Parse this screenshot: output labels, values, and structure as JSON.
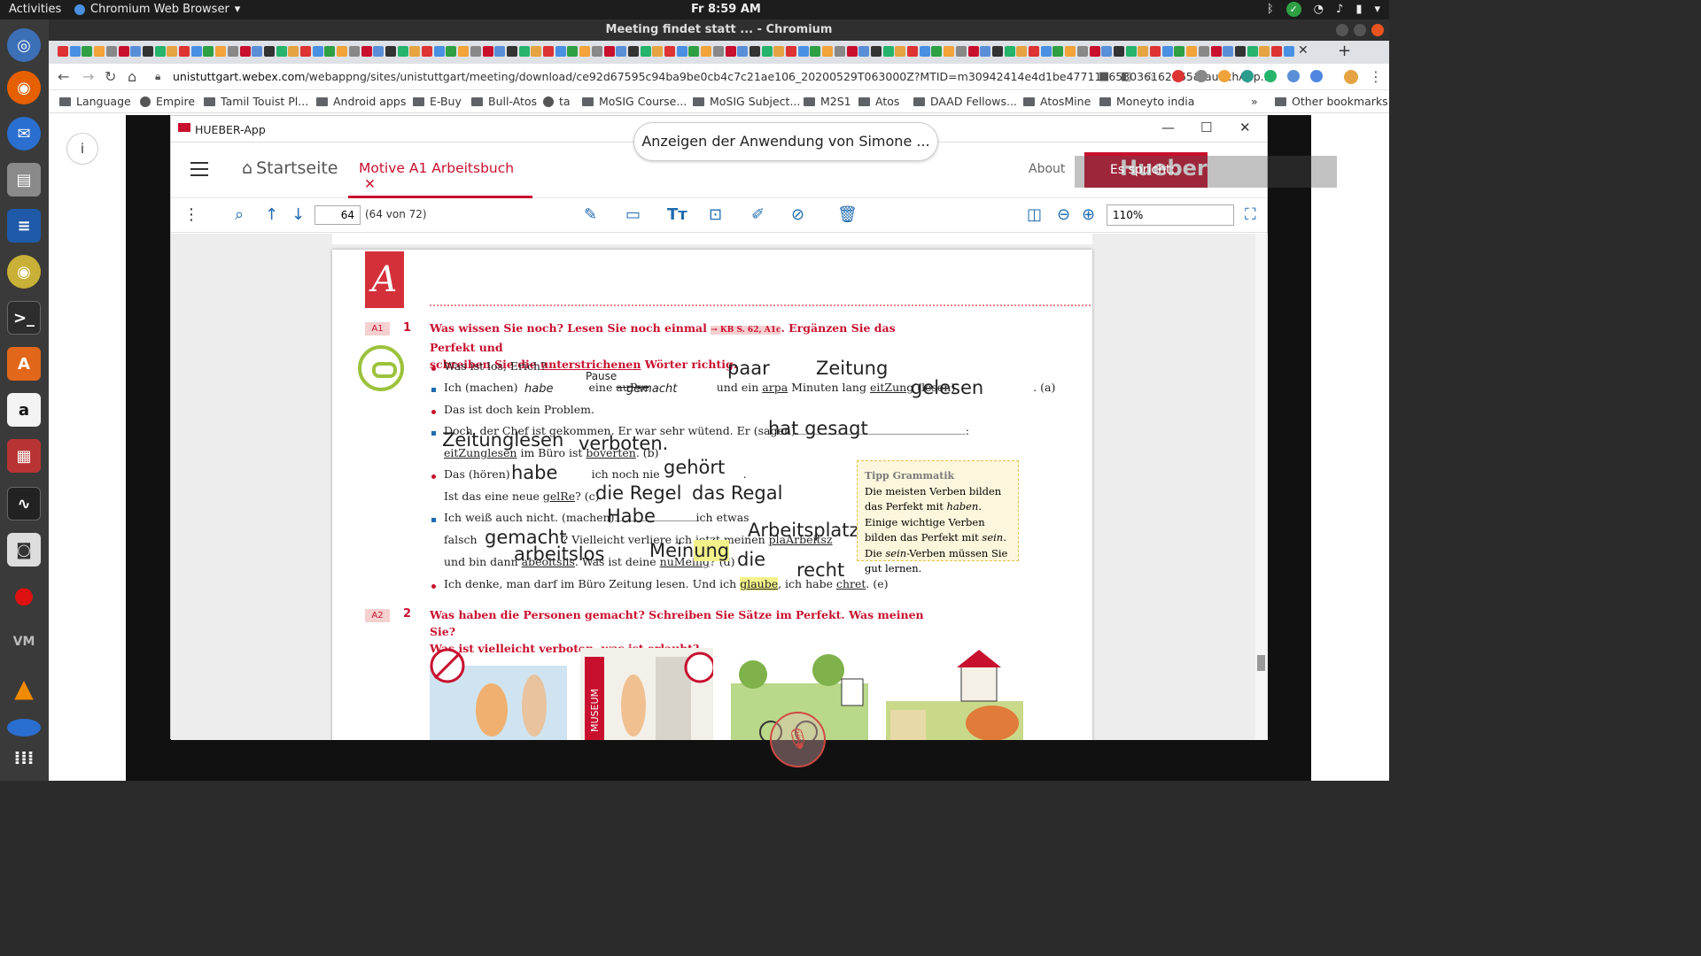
{
  "topbar": {
    "activities": "Activities",
    "app_name": "Chromium Web Browser",
    "clock": "Fr  8:59 AM"
  },
  "window": {
    "title": "Meeting findet statt ... - Chromium"
  },
  "navbar": {
    "url_host": "unistuttgart.webex.com",
    "url_path": "/webappng/sites/unistuttgart/meeting/download/ce92d67595c94ba9be0cb4c7c21ae106_20200529T063000Z?MTID=m30942414e4d1be477113653036162165&launchApp..."
  },
  "bookmarks": [
    {
      "label": "Language",
      "icon": "folder-icon"
    },
    {
      "label": "Empire",
      "icon": "globe-icon"
    },
    {
      "label": "Tamil Touist Pl...",
      "icon": "folder-icon"
    },
    {
      "label": "Android apps",
      "icon": "folder-icon"
    },
    {
      "label": "E-Buy",
      "icon": "folder-icon"
    },
    {
      "label": "Bull-Atos",
      "icon": "folder-icon"
    },
    {
      "label": "ta",
      "icon": "page-icon"
    },
    {
      "label": "MoSIG Course...",
      "icon": "folder-icon"
    },
    {
      "label": "MoSIG Subject...",
      "icon": "folder-icon"
    },
    {
      "label": "M2S1",
      "icon": "folder-icon"
    },
    {
      "label": "Atos",
      "icon": "folder-icon"
    },
    {
      "label": "DAAD Fellows...",
      "icon": "folder-icon"
    },
    {
      "label": "AtosMine",
      "icon": "folder-icon"
    },
    {
      "label": "Moneyto india",
      "icon": "folder-icon"
    }
  ],
  "bookmarks_overflow": "»",
  "other_bookmarks": "Other bookmarks",
  "share_banner": "Anzeigen der Anwendung von Simone ...",
  "hueber": {
    "window_title": "HUEBER-App",
    "home": "Startseite",
    "book_tab": "Motive A1 Arbeitsbuch",
    "about": "About",
    "logo": "Hueber",
    "speaking": "Es spricht:",
    "page_input": "64",
    "page_count": "(64 von 72)",
    "zoom": "110%"
  },
  "pdf": {
    "letter": "A",
    "ex1": {
      "badge": "A1",
      "num": "1",
      "task_1": "Was wissen Sie noch? Lesen Sie noch einmal",
      "task_ref": "→ KB S. 62, A1c",
      "task_2": ". Ergänzen Sie das Perfekt und",
      "task_3a": "schreiben Sie die ",
      "task_3u": "unterstrichenen",
      "task_3b": " Wörter richtig."
    },
    "ex2": {
      "badge": "A2",
      "num": "2",
      "task_1": "Was haben die Personen gemacht? Schreiben Sie Sätze im Perfekt. Was meinen Sie?",
      "task_2": "Was ist vielleicht verboten, was ist erlaubt?"
    },
    "lines": {
      "l1": "Was ist los, Erich?",
      "l2a": "Ich (machen)",
      "l2b": "eine",
      "l2c": "auPse",
      "l2d": "und ein",
      "l2e": "arpa",
      "l2f": "Minuten lang",
      "l2g": "eitZung",
      "l2h": "(lesen)",
      "l2i": ". (a)",
      "l3": "Das ist doch kein Problem.",
      "l4a": "Doch, der Chef ist gekommen. Er war sehr wütend. Er (sagen)",
      "l4b": ":",
      "l5a": "eitZunglesen",
      "l5b": "im Büro ist",
      "l5c": "boverten",
      "l5d": ". (b)",
      "l6a": "Das (hören)",
      "l6b": "ich noch nie",
      "l6c": ".",
      "l7a": "Ist das eine neue",
      "l7b": "gelRe",
      "l7c": "? (c)",
      "l8a": "Ich weiß auch nicht. (machen)",
      "l8b": "ich etwas",
      "l9a": "falsch",
      "l9b": "? Vielleicht verliere ich jetzt meinen",
      "l9c": "plaArbeitsz",
      "l10a": "und bin dann",
      "l10b": "abeoitslis",
      "l10c": ". Was ist deine",
      "l10d": "nuMeing",
      "l10e": "? (d)",
      "l11a": "Ich denke, man darf im Büro Zeitung lesen. Und ich",
      "l11b": "glaube",
      "l11c": ", ich habe",
      "l11d": "chret",
      "l11e": ". (e)"
    },
    "handwriting": {
      "habe_small": "habe",
      "pause": "Pause",
      "gemacht_small": "gemacht",
      "paar": "paar",
      "zeitung": "Zeitung",
      "gelesen": "gelesen",
      "hat_gesagt": "hat gesagt",
      "zeitunglesen": "Zeitunglesen",
      "verboten": "verboten.",
      "habe": "habe",
      "gehoert": "gehört",
      "die_regel": "die Regel",
      "das_regal": "das Regal",
      "habe2": "Habe",
      "arbeitsplatz": "Arbeitsplatz",
      "gemacht": "gemacht",
      "arbeitslos": "arbeitslos",
      "meinung_a": "Mein",
      "meinung_b": "ung",
      "die": "die",
      "recht": "recht"
    },
    "tipp": {
      "heading": "Tipp Grammatik",
      "text_1": "Die meisten Verben bilden das Perfekt mit ",
      "text_1i": "haben",
      "text_2": ". Einige wichtige Verben bilden das Perfekt mit ",
      "text_2i": "sein",
      "text_3": ". Die ",
      "text_3i": "sein",
      "text_4": "-Verben müssen Sie gut lernen."
    },
    "museum_sign": "MUSEUM"
  },
  "icons": {
    "colors": {
      "hueber_red": "#c8102e",
      "toolbar_blue": "#1f6bb0",
      "mute_red": "#d04a44"
    }
  }
}
